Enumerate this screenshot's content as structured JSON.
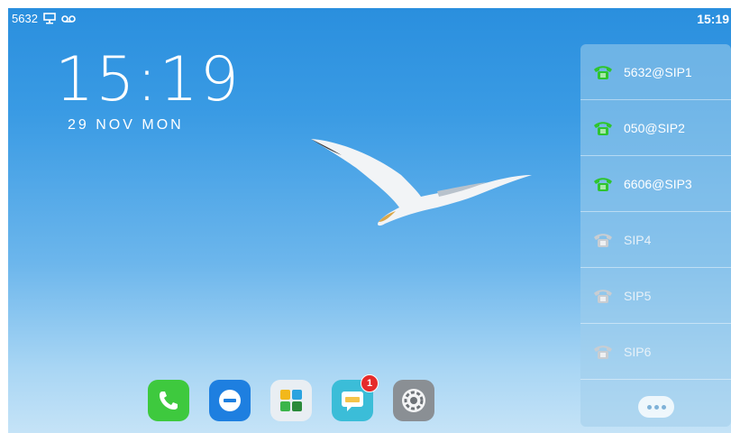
{
  "status": {
    "extension": "5632",
    "time": "15:19"
  },
  "clock": {
    "time": "15:19",
    "date": "29 NOV MON"
  },
  "accounts": [
    {
      "label": "5632@SIP1",
      "state": "registered"
    },
    {
      "label": "050@SIP2",
      "state": "registered"
    },
    {
      "label": "6606@SIP3",
      "state": "registered"
    },
    {
      "label": "SIP4",
      "state": "inactive"
    },
    {
      "label": "SIP5",
      "state": "inactive"
    },
    {
      "label": "SIP6",
      "state": "inactive"
    }
  ],
  "dock": [
    {
      "name": "phone-app-icon",
      "color": "#3ec93e"
    },
    {
      "name": "dnd-app-icon",
      "color": "#1e7fe0"
    },
    {
      "name": "apps-grid-icon",
      "color": "#e9eef3"
    },
    {
      "name": "messages-app-icon",
      "color": "#3bbdd8",
      "badge": "1"
    },
    {
      "name": "settings-app-icon",
      "color": "#8a8f94"
    }
  ],
  "colors": {
    "registered_phone": "#2fc52f",
    "inactive_phone": "#c8cdd2",
    "badge": "#e52b2b"
  }
}
